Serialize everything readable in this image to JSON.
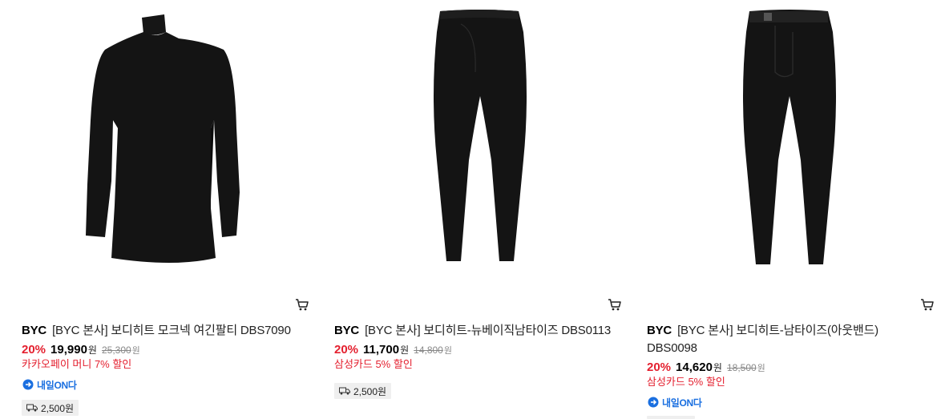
{
  "products": [
    {
      "brand": "BYC",
      "name": "[BYC 본사] 보디히트 모크넥 여긴팔티 DBS7090",
      "discount": "20%",
      "price": "19,990",
      "price_unit": "원",
      "original_price": "25,300",
      "original_unit": "원",
      "promo": "카카오페이 머니 7% 할인",
      "badge": "내일ON다",
      "shipping": "2,500원"
    },
    {
      "brand": "BYC",
      "name": "[BYC 본사] 보디히트-뉴베이직남타이즈 DBS0113",
      "discount": "20%",
      "price": "11,700",
      "price_unit": "원",
      "original_price": "14,800",
      "original_unit": "원",
      "promo": "삼성카드 5% 할인",
      "shipping": "2,500원"
    },
    {
      "brand": "BYC",
      "name": "[BYC 본사] 보디히트-남타이즈(아웃밴드) DBS0098",
      "discount": "20%",
      "price": "14,620",
      "price_unit": "원",
      "original_price": "18,500",
      "original_unit": "원",
      "promo": "삼성카드 5% 할인",
      "badge": "내일ON다",
      "shipping": ""
    }
  ],
  "icons": {
    "cart": "cart-icon",
    "badge": "delivery-badge-icon",
    "truck": "truck-icon"
  },
  "colors": {
    "discount": "#e4202f",
    "badge": "#1a6fe0",
    "shipping_bg": "#efefef"
  }
}
